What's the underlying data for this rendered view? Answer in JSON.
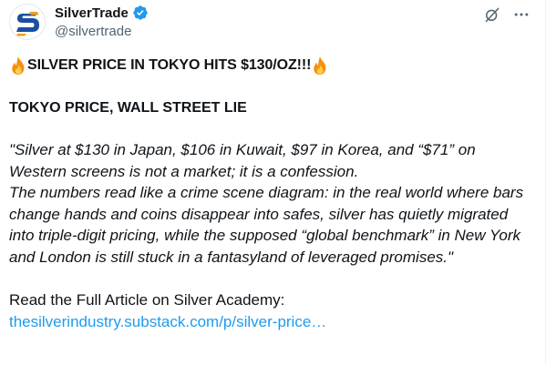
{
  "author": {
    "display_name": "SilverTrade",
    "handle": "@silvertrade",
    "verified": true,
    "avatar_logo": "S"
  },
  "icons": {
    "verified": "verified-badge-icon",
    "grok": "grok-icon",
    "more": "more-options-icon",
    "fire": "fire-emoji-icon"
  },
  "colors": {
    "link": "#1d9bf0",
    "verified": "#1d9bf0",
    "secondary_text": "#536471",
    "avatar_blue": "#1a4fa0",
    "avatar_orange": "#f39a1e"
  },
  "post": {
    "headline": "SILVER PRICE IN TOKYO HITS $130/OZ!!!",
    "subheadline": "TOKYO PRICE, WALL STREET LIE",
    "quote_paragraph_1": "\"Silver at $130 in Japan, $106 in Kuwait, $97 in Korea, and “$71” on Western screens is not a market; it is a confession.",
    "quote_paragraph_2": "The numbers read like a crime scene diagram: in the real world where bars change hands and coins disappear into safes, silver has quietly migrated into triple-digit pricing, while the supposed “global benchmark” in New York and London is still stuck in a fantasyland of leveraged promises.\"",
    "read_more_label": "Read the Full Article on Silver Academy:",
    "link_text": "thesilverindustry.substack.com/p/silver-price…"
  }
}
